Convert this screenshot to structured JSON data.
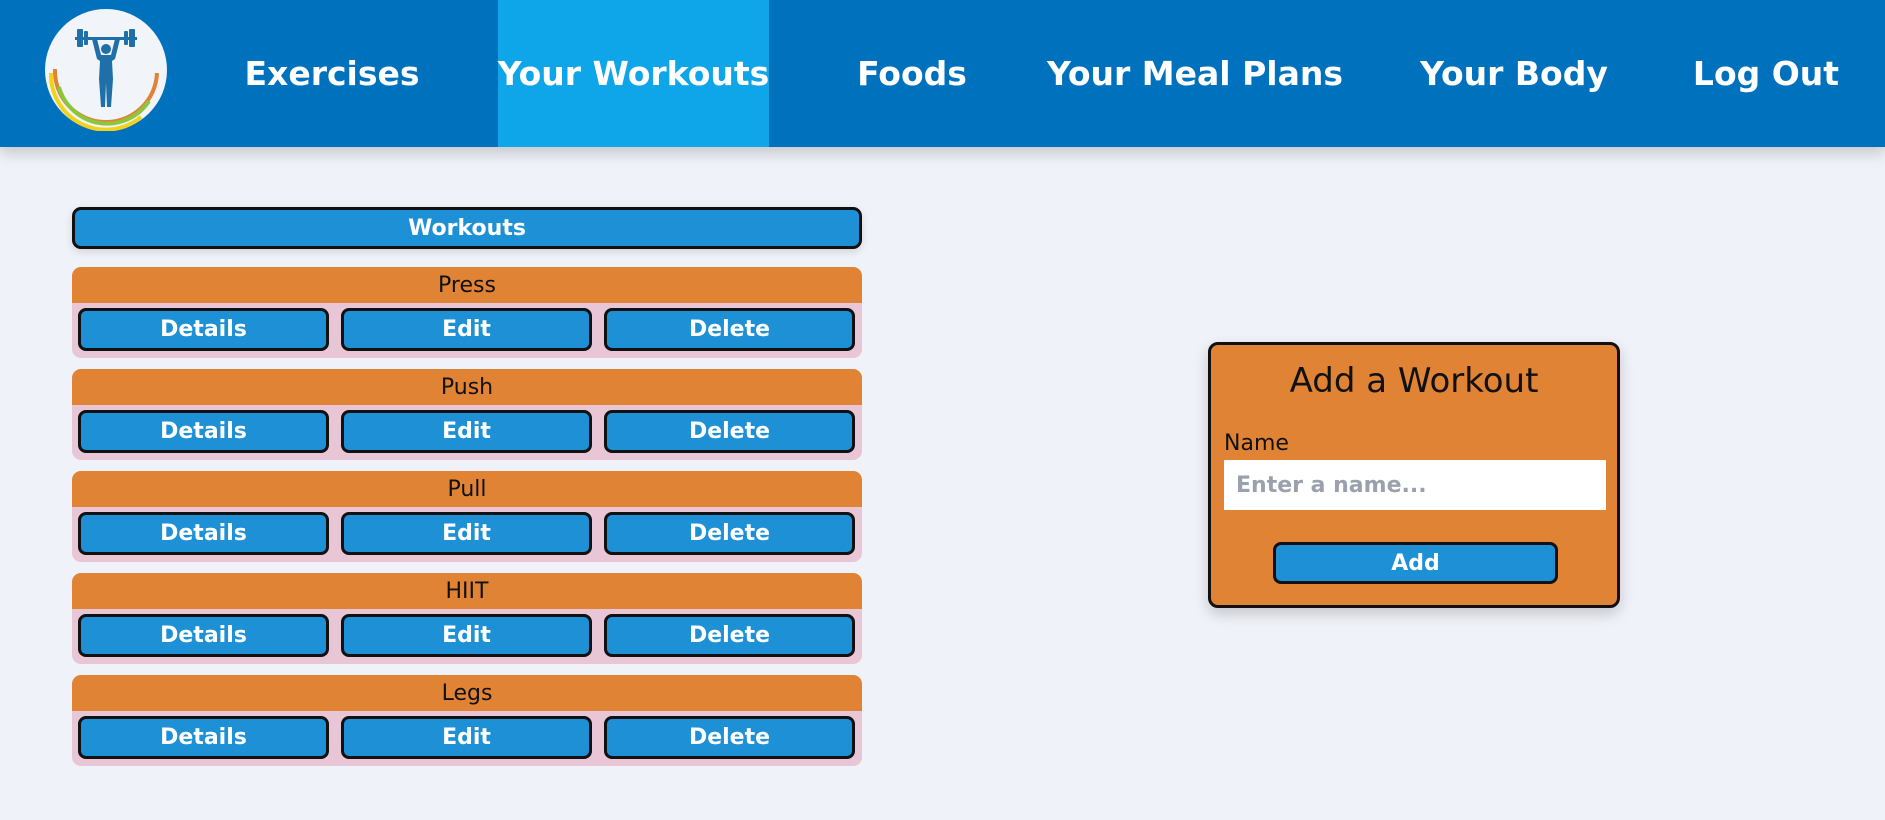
{
  "colors": {
    "nav_bg": "#0072bd",
    "nav_active": "#0ea5e9",
    "button_blue": "#1e90d6",
    "card_orange": "#e18335",
    "card_pink": "#e8c6d6",
    "page_bg": "#eff2f8"
  },
  "logo": {
    "icon": "weightlifter-logo-icon"
  },
  "nav": {
    "items": [
      {
        "label": "Exercises",
        "active": false
      },
      {
        "label": "Your Workouts",
        "active": true
      },
      {
        "label": "Foods",
        "active": false
      },
      {
        "label": "Your Meal Plans",
        "active": false
      },
      {
        "label": "Your Body",
        "active": false
      },
      {
        "label": "Log Out",
        "active": false
      }
    ]
  },
  "workouts": {
    "header": "Workouts",
    "items": [
      {
        "name": "Press",
        "details": "Details",
        "edit": "Edit",
        "delete": "Delete"
      },
      {
        "name": "Push",
        "details": "Details",
        "edit": "Edit",
        "delete": "Delete"
      },
      {
        "name": "Pull",
        "details": "Details",
        "edit": "Edit",
        "delete": "Delete"
      },
      {
        "name": "HIIT",
        "details": "Details",
        "edit": "Edit",
        "delete": "Delete"
      },
      {
        "name": "Legs",
        "details": "Details",
        "edit": "Edit",
        "delete": "Delete"
      }
    ]
  },
  "add_form": {
    "title": "Add a Workout",
    "name_label": "Name",
    "name_placeholder": "Enter a name...",
    "name_value": "",
    "submit": "Add"
  }
}
